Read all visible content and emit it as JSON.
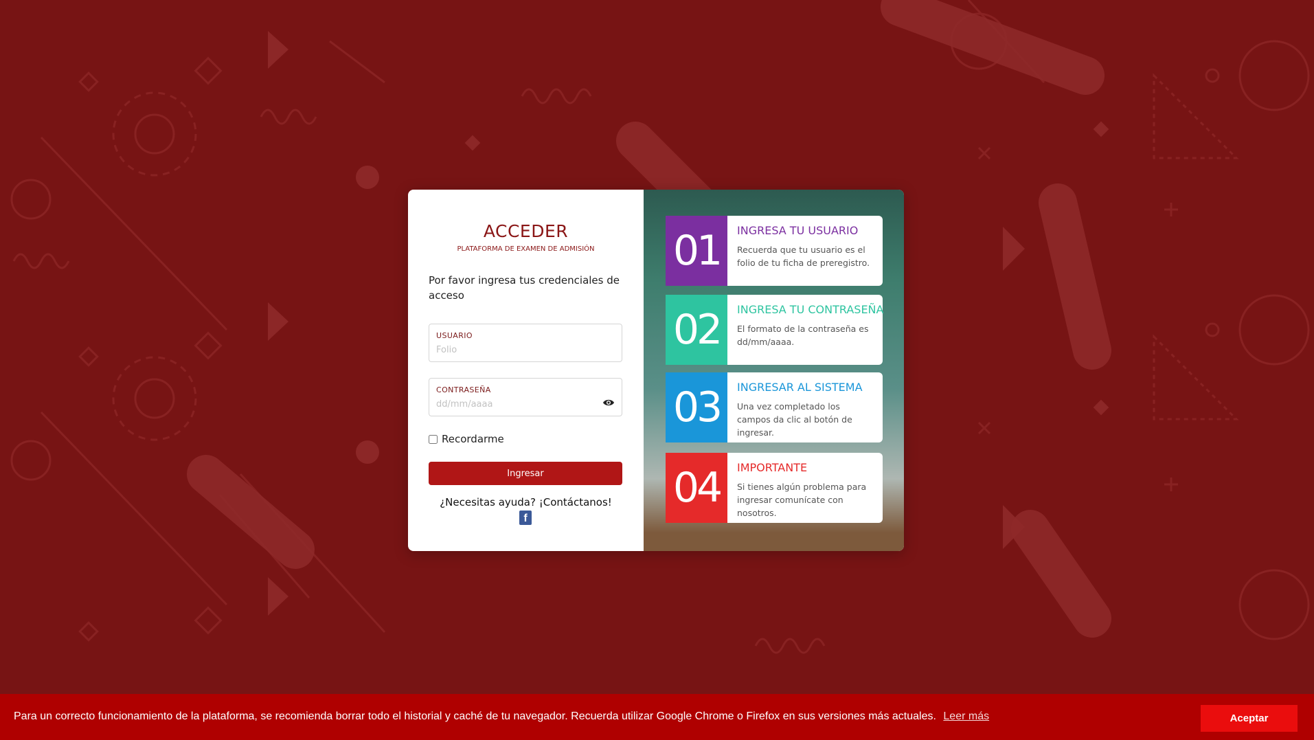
{
  "colors": {
    "background": "#771414",
    "accent": "#b01616",
    "cookie_bar": "#af0000",
    "accept_button": "#ea0d0d"
  },
  "login": {
    "title": "ACCEDER",
    "subtitle": "PLATAFORMA DE EXAMEN DE ADMISIÓN",
    "intro": "Por favor ingresa tus credenciales de acceso",
    "username": {
      "label": "USUARIO",
      "placeholder": "Folio",
      "value": ""
    },
    "password": {
      "label": "CONTRASEÑA",
      "placeholder": "dd/mm/aaaa",
      "value": "",
      "toggle_icon": "eye-icon"
    },
    "remember_label": "Recordarme",
    "remember_checked": false,
    "submit_label": "Ingresar",
    "help_text": "¿Necesitas ayuda? ¡Contáctanos!",
    "social_icon": "facebook-icon"
  },
  "steps": [
    {
      "number": "01",
      "title": "INGRESA TU USUARIO",
      "text": "Recuerda que tu usuario es el folio de tu ficha de preregistro.",
      "color": "#7b2fa0"
    },
    {
      "number": "02",
      "title": "INGRESA TU CONTRASEÑA",
      "text": "El formato de la contraseña es dd/mm/aaaa.",
      "color": "#2ec4a0"
    },
    {
      "number": "03",
      "title": "INGRESAR AL SISTEMA",
      "text": "Una vez completado los campos da clic al botón de ingresar.",
      "color": "#1a96d9"
    },
    {
      "number": "04",
      "title": "IMPORTANTE",
      "text": "Si tienes algún problema para ingresar comunícate con nosotros.",
      "color": "#e52a2a"
    }
  ],
  "cookie": {
    "message": "Para un correcto funcionamiento de la plataforma, se recomienda borrar todo el historial y caché de tu navegador. Recuerda utilizar Google Chrome o Firefox en sus versiones más actuales.",
    "link": "Leer más",
    "accept": "Aceptar"
  }
}
